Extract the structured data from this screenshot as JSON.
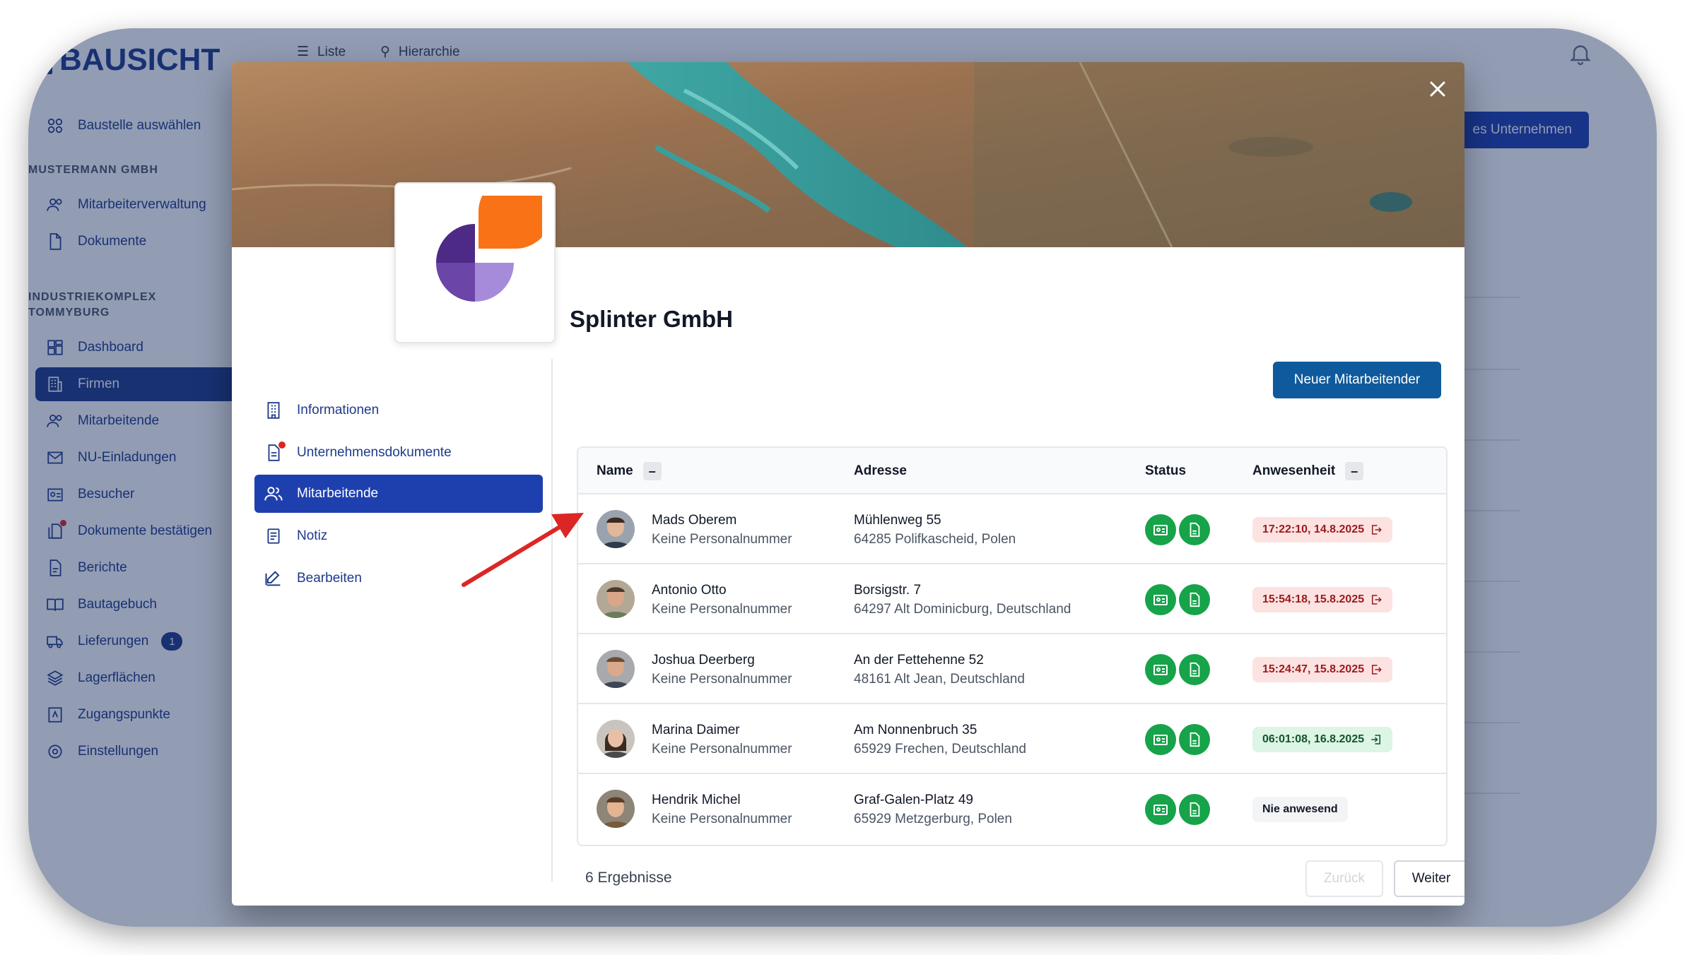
{
  "app": {
    "logo_text": "BAUSICHT",
    "top_nav": {
      "list_label": "Liste",
      "hierarchy_label": "Hierarchie"
    },
    "header_button_partial": "es Unternehmen",
    "sidebar": {
      "select_site_label": "Baustelle auswählen",
      "section1_header": "MUSTERMANN GMBH",
      "section1_items": [
        "Mitarbeiterverwaltung",
        "Dokumente"
      ],
      "section2_header_line1": "INDUSTRIEKOMPLEX",
      "section2_header_line2": "TOMMYBURG",
      "section2_items": [
        "Dashboard",
        "Firmen",
        "Mitarbeitende",
        "NU-Einladungen",
        "Besucher",
        "Dokumente bestätigen",
        "Berichte",
        "Bautagebuch",
        "Lieferungen",
        "Lagerflächen",
        "Zugangspunkte",
        "Einstellungen"
      ],
      "active_item": "Firmen",
      "deliveries_badge": "1"
    }
  },
  "modal": {
    "company_name": "Splinter GmbH",
    "nav": {
      "items": [
        "Informationen",
        "Unternehmensdokumente",
        "Mitarbeitende",
        "Notiz",
        "Bearbeiten"
      ],
      "active": "Mitarbeitende"
    },
    "new_employee_button": "Neuer Mitarbeitender",
    "table": {
      "headers": {
        "name": "Name",
        "address": "Adresse",
        "status": "Status",
        "presence": "Anwesenheit"
      },
      "sort_symbol": "–",
      "rows": [
        {
          "name": "Mads Oberem",
          "subtitle": "Keine Personalnummer",
          "street": "Mühlenweg 55",
          "city": "64285 Polifkascheid, Polen",
          "presence": "17:22:10, 14.8.2025",
          "presence_state": "out"
        },
        {
          "name": "Antonio Otto",
          "subtitle": "Keine Personalnummer",
          "street": "Borsigstr. 7",
          "city": "64297 Alt Dominicburg, Deutschland",
          "presence": "15:54:18, 15.8.2025",
          "presence_state": "out"
        },
        {
          "name": "Joshua Deerberg",
          "subtitle": "Keine Personalnummer",
          "street": "An der Fettehenne 52",
          "city": "48161 Alt Jean, Deutschland",
          "presence": "15:24:47, 15.8.2025",
          "presence_state": "out"
        },
        {
          "name": "Marina Daimer",
          "subtitle": "Keine Personalnummer",
          "street": "Am Nonnenbruch 35",
          "city": "65929 Frechen, Deutschland",
          "presence": "06:01:08, 16.8.2025",
          "presence_state": "in"
        },
        {
          "name": "Hendrik Michel",
          "subtitle": "Keine Personalnummer",
          "street": "Graf-Galen-Platz 49",
          "city": "65929 Metzgerburg, Polen",
          "presence": "Nie anwesend",
          "presence_state": "none"
        }
      ]
    },
    "results_count": "6 Ergebnisse",
    "pagination": {
      "prev": "Zurück",
      "next": "Weiter"
    }
  },
  "colors": {
    "primary": "#1e40af",
    "overlay": "#11285a",
    "status_green": "#16a34a",
    "presence_out_bg": "#fde2e2",
    "presence_in_bg": "#dcf5e4",
    "arrow": "#dc2626",
    "logo_orange": "#f97316",
    "logo_purple_dark": "#4c2a85",
    "logo_purple_light": "#a78bdb"
  },
  "icons": [
    "close-icon",
    "building-icon",
    "document-icon",
    "users-icon",
    "note-icon",
    "edit-icon",
    "id-card-icon",
    "file-icon",
    "logout-icon",
    "login-icon",
    "bell-icon",
    "list-icon",
    "hierarchy-icon"
  ]
}
